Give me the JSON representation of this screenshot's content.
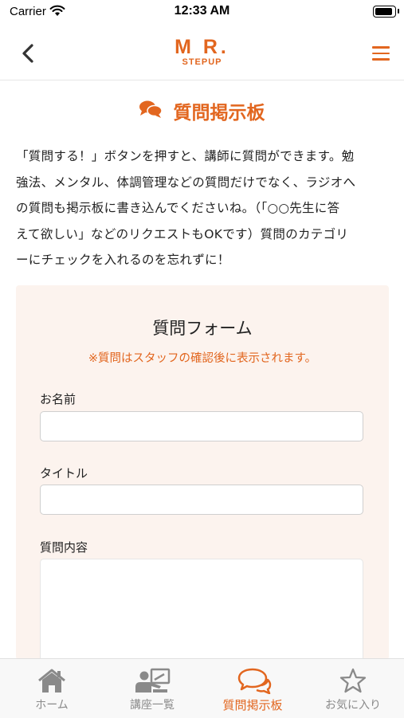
{
  "status_bar": {
    "carrier": "Carrier",
    "time": "12:33 AM"
  },
  "header": {
    "logo_main": "M R.",
    "logo_sub": "STEPUP"
  },
  "page": {
    "title": "質問掲示板",
    "intro_lines": [
      "「質問する！」ボタンを押すと、講師に質問ができます。勉",
      "強法、メンタル、体調管理などの質問だけでなく、ラジオへ",
      "の質問も掲示板に書き込んでくださいね。（「○○先生に答",
      "えて欲しい」などのリクエストもOKです）質問のカテゴリ",
      "ーにチェックを入れるのを忘れずに！"
    ]
  },
  "form": {
    "title": "質問フォーム",
    "note": "※質問はスタッフの確認後に表示されます。",
    "name_label": "お名前",
    "name_value": "",
    "title_label": "タイトル",
    "title_value": "",
    "content_label": "質問内容",
    "content_value": ""
  },
  "tabbar": {
    "tabs": [
      {
        "label": "ホーム",
        "icon": "home-icon"
      },
      {
        "label": "講座一覧",
        "icon": "lecture-icon"
      },
      {
        "label": "質問掲示板",
        "icon": "chat-icon"
      },
      {
        "label": "お気に入り",
        "icon": "star-icon"
      }
    ],
    "active_index": 2
  },
  "colors": {
    "accent": "#e2661f",
    "form_bg": "#fcf3ee",
    "inactive": "#8a8a8a"
  }
}
